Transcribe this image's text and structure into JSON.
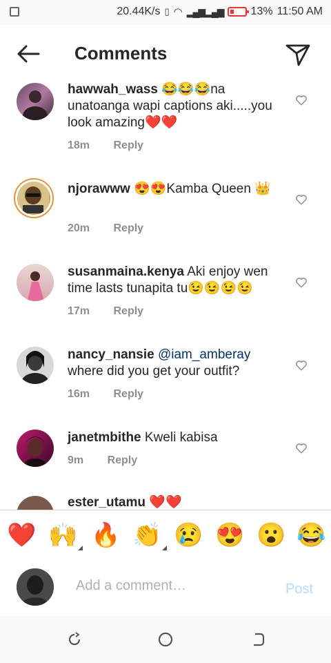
{
  "status_bar": {
    "speed": "20.44K/s",
    "battery": "13%",
    "time": "11:50 AM"
  },
  "header": {
    "title": "Comments"
  },
  "comments": [
    {
      "username": "hawwah_wass",
      "text": "😂😂😂na unatoanga wapi captions aki.....you look amazing❤️❤️",
      "time": "18m",
      "reply": "Reply"
    },
    {
      "username": "njorawww",
      "text": "😍😍Kamba Queen 👑",
      "time": "20m",
      "reply": "Reply"
    },
    {
      "username": "susanmaina.kenya",
      "text": "Aki enjoy wen time lasts tunapita tu😉😉😉😉",
      "time": "17m",
      "reply": "Reply"
    },
    {
      "username": "nancy_nansie",
      "mention": "@iam_amberay",
      "text": "where did you get your outfit?",
      "time": "16m",
      "reply": "Reply"
    },
    {
      "username": "janetmbithe",
      "text": "Kweli kabisa",
      "time": "9m",
      "reply": "Reply"
    },
    {
      "username": "ester_utamu",
      "text": "❤️❤️"
    }
  ],
  "emoji_bar": [
    "❤️",
    "🙌",
    "🔥",
    "👏",
    "😢",
    "😍",
    "😮",
    "😂"
  ],
  "composer": {
    "placeholder": "Add a comment…",
    "post_label": "Post"
  },
  "colors": {
    "accent": "#3897f0",
    "post_disabled": "#b3dbff",
    "meta": "#8e8e8e",
    "battery_low": "#e33333"
  }
}
